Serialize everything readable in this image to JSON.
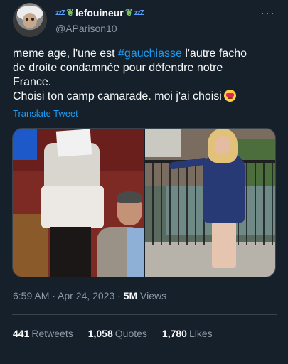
{
  "author": {
    "display_name": "lefouineur",
    "sleep_prefix": "zzZ",
    "sleep_suffix": "zzZ",
    "handle": "@AParison10",
    "avatar_icon": "einstein-avatar",
    "leaf_icon": "olive-branch-icon"
  },
  "more_icon": "more-options-icon",
  "tweet": {
    "line1_pre": "meme age, l'une est ",
    "hashtag": "#gauchiasse",
    "line1_post": " l'autre facho",
    "line2": "de droite condamnée pour défendre notre",
    "line3": "France.",
    "line4": "Choisi ton camp camarade. moi j'ai choisi",
    "emoji": "face-with-heart-eyes-emoji"
  },
  "translate_label": "Translate Tweet",
  "meta": {
    "time": "6:59 AM",
    "separator": "·",
    "date": "Apr 24, 2023",
    "views_count": "5M",
    "views_label": "Views"
  },
  "stats": {
    "retweets_count": "441",
    "retweets_label": "Retweets",
    "quotes_count": "1,058",
    "quotes_label": "Quotes",
    "likes_count": "1,780",
    "likes_label": "Likes"
  },
  "colors": {
    "background": "#15202b",
    "link": "#1d9bf0",
    "secondary_text": "#8b98a5",
    "primary_text": "#f7f9f9",
    "divider": "#38444d"
  }
}
